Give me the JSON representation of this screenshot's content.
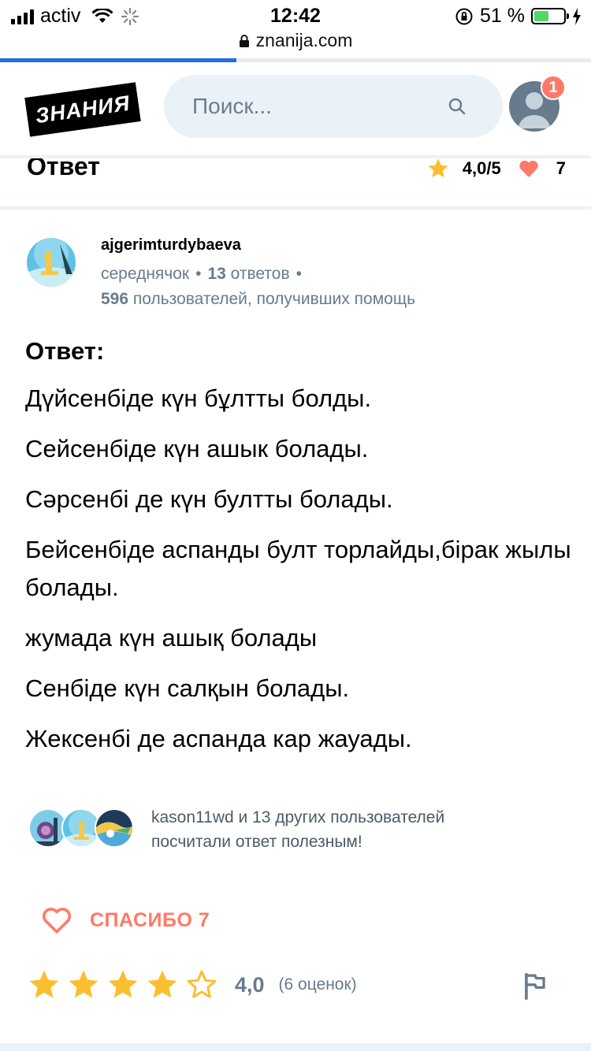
{
  "status_bar": {
    "carrier": "activ",
    "time": "12:42",
    "battery_percent": "51 %",
    "battery_level": 0.51
  },
  "browser": {
    "url": "znanija.com",
    "load_progress": 0.4
  },
  "header": {
    "logo": "ЗНАНИЯ",
    "search_placeholder": "Поиск...",
    "notifications_count": "1"
  },
  "section": {
    "title": "Ответ",
    "rating": "4,0/5",
    "thanks_count": "7"
  },
  "author": {
    "name": "ajgerimturdybaeva",
    "rank": "середнячок",
    "answers_count": "13",
    "answers_label": "ответов",
    "helped_count": "596",
    "helped_label": "пользователей, получивших помощь"
  },
  "answer": {
    "label": "Ответ:",
    "lines": [
      "Дүйсенбіде күн бұлтты болды.",
      "Сейсенбіде күн ашык болады.",
      "Сәрсенбі де күн бултты болады.",
      "Бейсенбіде аспанды булт торлайды,бірак жылы болады.",
      "жумада күн ашық болады",
      "Сенбіде күн салқын болады.",
      "Жексенбі де аспанда кар жауады."
    ]
  },
  "helpers": {
    "line1": "kason11wd и 13 других пользователей",
    "line2": "посчитали ответ полезным!"
  },
  "thanks": {
    "label": "СПАСИБО 7"
  },
  "rating": {
    "value": "4,0",
    "count": "(6 оценок)",
    "stars_filled": 4,
    "stars_total": 5
  },
  "colors": {
    "accent_coral": "#ff7968",
    "star_yellow": "#fbbe2e",
    "muted_gray": "#687b8c",
    "link_blue": "#1f6fe5"
  }
}
